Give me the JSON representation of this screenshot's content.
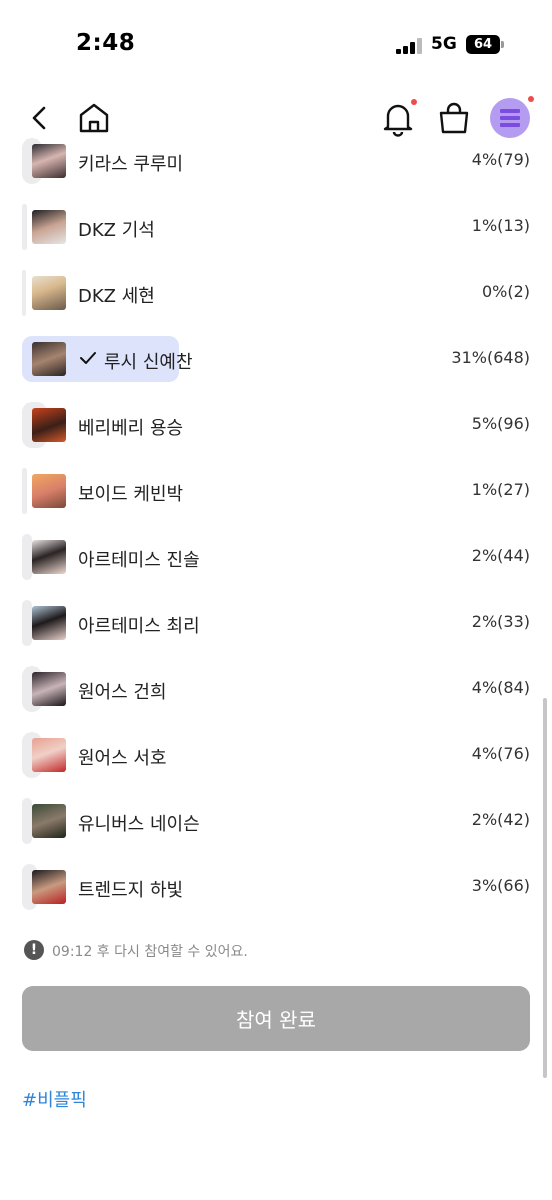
{
  "status_bar": {
    "time": "2:48",
    "network": "5G",
    "battery": "64"
  },
  "nav": {
    "back_icon": "chevron-left-icon",
    "home_icon": "home-icon",
    "bell_icon": "bell-icon",
    "bag_icon": "shopping-bag-icon",
    "menu_icon": "menu-icon"
  },
  "colors": {
    "bar_track": "#ececef",
    "selected_track": "#dde3fb",
    "button_disabled": "#a8a8a8",
    "hashtag": "#2f86d9",
    "notification_dot": "#f04b4b",
    "menu_button": "#b49cf0"
  },
  "vote_items": [
    {
      "name": "키라스 쿠루미",
      "result": "4%(79)",
      "percent": 4,
      "selected": false
    },
    {
      "name": "DKZ 기석",
      "result": "1%(13)",
      "percent": 1,
      "selected": false
    },
    {
      "name": "DKZ 세현",
      "result": "0%(2)",
      "percent": 0,
      "selected": false
    },
    {
      "name": "루시 신예찬",
      "result": "31%(648)",
      "percent": 31,
      "selected": true
    },
    {
      "name": "베리베리 용승",
      "result": "5%(96)",
      "percent": 5,
      "selected": false
    },
    {
      "name": "보이드 케빈박",
      "result": "1%(27)",
      "percent": 1,
      "selected": false
    },
    {
      "name": "아르테미스 진솔",
      "result": "2%(44)",
      "percent": 2,
      "selected": false
    },
    {
      "name": "아르테미스 최리",
      "result": "2%(33)",
      "percent": 2,
      "selected": false
    },
    {
      "name": "원어스 건희",
      "result": "4%(84)",
      "percent": 4,
      "selected": false
    },
    {
      "name": "원어스 서호",
      "result": "4%(76)",
      "percent": 4,
      "selected": false
    },
    {
      "name": "유니버스 네이슨",
      "result": "2%(42)",
      "percent": 2,
      "selected": false
    },
    {
      "name": "트렌드지 하빛",
      "result": "3%(66)",
      "percent": 3,
      "selected": false
    }
  ],
  "notice": {
    "icon": "exclamation-icon",
    "text": "09:12 후 다시 참여할 수 있어요."
  },
  "submit_button": {
    "label": "참여 완료"
  },
  "hashtag": "#비플픽"
}
